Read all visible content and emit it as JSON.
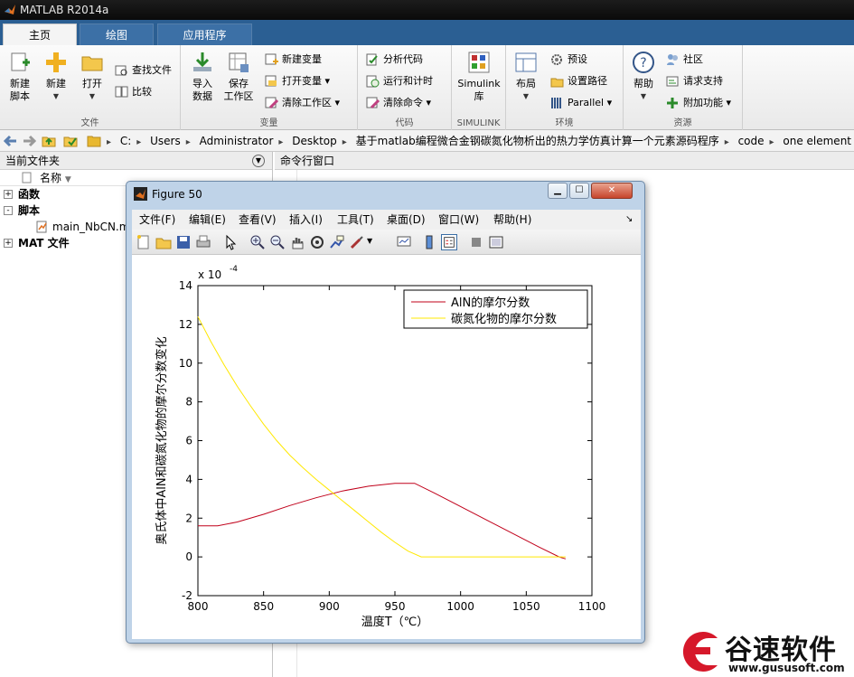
{
  "app": {
    "title": "MATLAB R2014a"
  },
  "tabs": [
    "主页",
    "绘图",
    "应用程序"
  ],
  "ribbon": {
    "file": {
      "label": "文件",
      "new_script": [
        "新建",
        "脚本"
      ],
      "new": "新建",
      "open": "打开",
      "find_files": "查找文件",
      "compare": "比较"
    },
    "variable": {
      "label": "变量",
      "import": [
        "导入",
        "数据"
      ],
      "save": [
        "保存",
        "工作区"
      ],
      "new_var": "新建变量",
      "open_var": "打开变量",
      "clear_ws": "清除工作区"
    },
    "code": {
      "label": "代码",
      "analyze": "分析代码",
      "run_time": "运行和计时",
      "clear_cmd": "清除命令"
    },
    "simulink": {
      "label": "SIMULINK",
      "btn": [
        "Simulink",
        "库"
      ]
    },
    "env": {
      "label": "环境",
      "layout": "布局",
      "prefs": "预设",
      "set_path": "设置路径",
      "parallel": "Parallel"
    },
    "resources": {
      "label": "资源",
      "help": "帮助",
      "community": "社区",
      "support": "请求支持",
      "addons": "附加功能"
    }
  },
  "address": [
    "C:",
    "Users",
    "Administrator",
    "Desktop",
    "基于matlab编程微合金钢碳氮化物析出的热力学仿真计算一个元素源码程序",
    "code",
    "one element"
  ],
  "left_panel": {
    "title": "当前文件夹",
    "col_name": "名称",
    "tree": [
      {
        "box": "+",
        "label": "函数"
      },
      {
        "box": "-",
        "label": "脚本"
      },
      {
        "file": "main_NbCN.m"
      },
      {
        "box": "+",
        "label": "MAT 文件"
      }
    ]
  },
  "cmd_panel": {
    "title": "命令行窗口"
  },
  "figure": {
    "title": "Figure 50",
    "menus": [
      "文件(F)",
      "编辑(E)",
      "查看(V)",
      "插入(I)",
      "工具(T)",
      "桌面(D)",
      "窗口(W)",
      "帮助(H)"
    ]
  },
  "chart_data": {
    "type": "line",
    "xlabel": "温度T（℃）",
    "ylabel": "奥氏体中AlN和碳氮化物的摩尔分数变化",
    "exponent": "x 10",
    "exponent_power": "-4",
    "xlim": [
      800,
      1100
    ],
    "ylim": [
      -2,
      14
    ],
    "xticks": [
      800,
      850,
      900,
      950,
      1000,
      1050,
      1100
    ],
    "yticks": [
      -2,
      0,
      2,
      4,
      6,
      8,
      10,
      12,
      14
    ],
    "legend_position": "top-right",
    "series": [
      {
        "name": "AlN的摩尔分数",
        "color": "#c0001a",
        "x": [
          800,
          815,
          830,
          850,
          870,
          890,
          910,
          930,
          950,
          965,
          980,
          1000,
          1020,
          1040,
          1060,
          1075,
          1080
        ],
        "y": [
          1.6,
          1.6,
          1.8,
          2.2,
          2.65,
          3.05,
          3.4,
          3.65,
          3.8,
          3.8,
          3.3,
          2.6,
          1.9,
          1.2,
          0.5,
          0.0,
          -0.1
        ]
      },
      {
        "name": "碳氮化物的摩尔分数",
        "color": "#ffe800",
        "x": [
          800,
          810,
          820,
          830,
          840,
          850,
          860,
          870,
          880,
          890,
          900,
          910,
          920,
          930,
          940,
          950,
          960,
          970,
          1000,
          1050,
          1080
        ],
        "y": [
          12.4,
          11.1,
          9.9,
          8.8,
          7.8,
          6.85,
          6.0,
          5.25,
          4.6,
          4.0,
          3.45,
          2.9,
          2.35,
          1.8,
          1.25,
          0.75,
          0.3,
          0.0,
          0.0,
          0.0,
          0.0
        ]
      }
    ]
  },
  "watermark": {
    "text": "谷速软件",
    "url": "www.gususoft.com"
  },
  "colors": {
    "tabbar": "#2b5f93",
    "ribbon": "#f0f0f0",
    "fig_frame": "#bfd3e8"
  }
}
